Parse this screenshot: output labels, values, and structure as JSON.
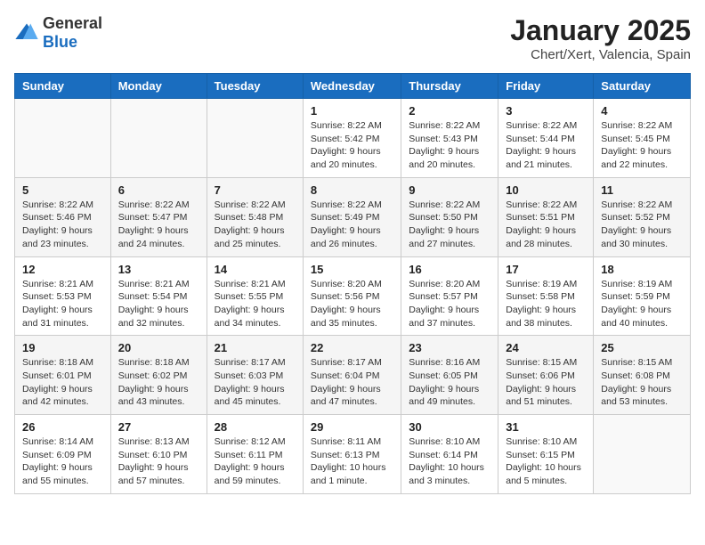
{
  "logo": {
    "general": "General",
    "blue": "Blue"
  },
  "title": "January 2025",
  "subtitle": "Chert/Xert, Valencia, Spain",
  "days_of_week": [
    "Sunday",
    "Monday",
    "Tuesday",
    "Wednesday",
    "Thursday",
    "Friday",
    "Saturday"
  ],
  "weeks": [
    [
      {
        "day": "",
        "info": ""
      },
      {
        "day": "",
        "info": ""
      },
      {
        "day": "",
        "info": ""
      },
      {
        "day": "1",
        "info": "Sunrise: 8:22 AM\nSunset: 5:42 PM\nDaylight: 9 hours and 20 minutes."
      },
      {
        "day": "2",
        "info": "Sunrise: 8:22 AM\nSunset: 5:43 PM\nDaylight: 9 hours and 20 minutes."
      },
      {
        "day": "3",
        "info": "Sunrise: 8:22 AM\nSunset: 5:44 PM\nDaylight: 9 hours and 21 minutes."
      },
      {
        "day": "4",
        "info": "Sunrise: 8:22 AM\nSunset: 5:45 PM\nDaylight: 9 hours and 22 minutes."
      }
    ],
    [
      {
        "day": "5",
        "info": "Sunrise: 8:22 AM\nSunset: 5:46 PM\nDaylight: 9 hours and 23 minutes."
      },
      {
        "day": "6",
        "info": "Sunrise: 8:22 AM\nSunset: 5:47 PM\nDaylight: 9 hours and 24 minutes."
      },
      {
        "day": "7",
        "info": "Sunrise: 8:22 AM\nSunset: 5:48 PM\nDaylight: 9 hours and 25 minutes."
      },
      {
        "day": "8",
        "info": "Sunrise: 8:22 AM\nSunset: 5:49 PM\nDaylight: 9 hours and 26 minutes."
      },
      {
        "day": "9",
        "info": "Sunrise: 8:22 AM\nSunset: 5:50 PM\nDaylight: 9 hours and 27 minutes."
      },
      {
        "day": "10",
        "info": "Sunrise: 8:22 AM\nSunset: 5:51 PM\nDaylight: 9 hours and 28 minutes."
      },
      {
        "day": "11",
        "info": "Sunrise: 8:22 AM\nSunset: 5:52 PM\nDaylight: 9 hours and 30 minutes."
      }
    ],
    [
      {
        "day": "12",
        "info": "Sunrise: 8:21 AM\nSunset: 5:53 PM\nDaylight: 9 hours and 31 minutes."
      },
      {
        "day": "13",
        "info": "Sunrise: 8:21 AM\nSunset: 5:54 PM\nDaylight: 9 hours and 32 minutes."
      },
      {
        "day": "14",
        "info": "Sunrise: 8:21 AM\nSunset: 5:55 PM\nDaylight: 9 hours and 34 minutes."
      },
      {
        "day": "15",
        "info": "Sunrise: 8:20 AM\nSunset: 5:56 PM\nDaylight: 9 hours and 35 minutes."
      },
      {
        "day": "16",
        "info": "Sunrise: 8:20 AM\nSunset: 5:57 PM\nDaylight: 9 hours and 37 minutes."
      },
      {
        "day": "17",
        "info": "Sunrise: 8:19 AM\nSunset: 5:58 PM\nDaylight: 9 hours and 38 minutes."
      },
      {
        "day": "18",
        "info": "Sunrise: 8:19 AM\nSunset: 5:59 PM\nDaylight: 9 hours and 40 minutes."
      }
    ],
    [
      {
        "day": "19",
        "info": "Sunrise: 8:18 AM\nSunset: 6:01 PM\nDaylight: 9 hours and 42 minutes."
      },
      {
        "day": "20",
        "info": "Sunrise: 8:18 AM\nSunset: 6:02 PM\nDaylight: 9 hours and 43 minutes."
      },
      {
        "day": "21",
        "info": "Sunrise: 8:17 AM\nSunset: 6:03 PM\nDaylight: 9 hours and 45 minutes."
      },
      {
        "day": "22",
        "info": "Sunrise: 8:17 AM\nSunset: 6:04 PM\nDaylight: 9 hours and 47 minutes."
      },
      {
        "day": "23",
        "info": "Sunrise: 8:16 AM\nSunset: 6:05 PM\nDaylight: 9 hours and 49 minutes."
      },
      {
        "day": "24",
        "info": "Sunrise: 8:15 AM\nSunset: 6:06 PM\nDaylight: 9 hours and 51 minutes."
      },
      {
        "day": "25",
        "info": "Sunrise: 8:15 AM\nSunset: 6:08 PM\nDaylight: 9 hours and 53 minutes."
      }
    ],
    [
      {
        "day": "26",
        "info": "Sunrise: 8:14 AM\nSunset: 6:09 PM\nDaylight: 9 hours and 55 minutes."
      },
      {
        "day": "27",
        "info": "Sunrise: 8:13 AM\nSunset: 6:10 PM\nDaylight: 9 hours and 57 minutes."
      },
      {
        "day": "28",
        "info": "Sunrise: 8:12 AM\nSunset: 6:11 PM\nDaylight: 9 hours and 59 minutes."
      },
      {
        "day": "29",
        "info": "Sunrise: 8:11 AM\nSunset: 6:13 PM\nDaylight: 10 hours and 1 minute."
      },
      {
        "day": "30",
        "info": "Sunrise: 8:10 AM\nSunset: 6:14 PM\nDaylight: 10 hours and 3 minutes."
      },
      {
        "day": "31",
        "info": "Sunrise: 8:10 AM\nSunset: 6:15 PM\nDaylight: 10 hours and 5 minutes."
      },
      {
        "day": "",
        "info": ""
      }
    ]
  ]
}
